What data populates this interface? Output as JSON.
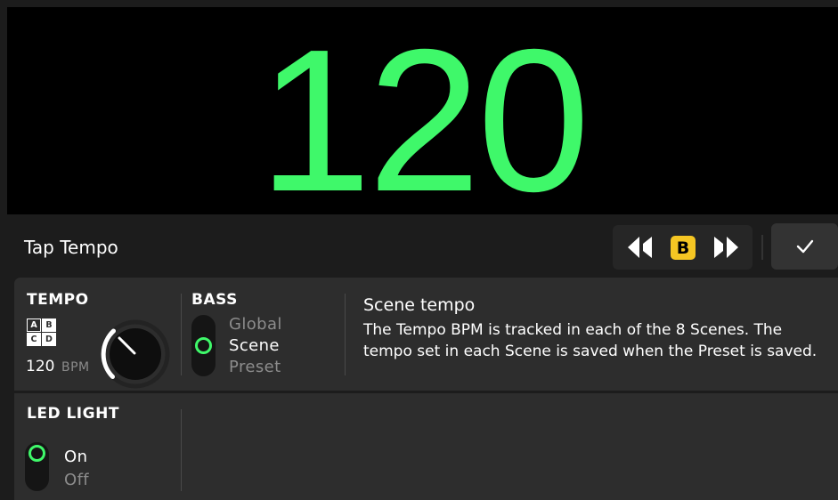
{
  "display": {
    "bpm": "120"
  },
  "header": {
    "title": "Tap Tempo",
    "scene_badge": "B",
    "icons": {
      "prev": "skip-previous-icon",
      "next": "skip-next-icon",
      "confirm": "checkmark-icon"
    }
  },
  "tempo": {
    "label": "TEMPO",
    "grid": [
      "A",
      "B",
      "C",
      "D"
    ],
    "value": "120",
    "unit": "BPM"
  },
  "bass": {
    "label": "BASS",
    "options": [
      "Global",
      "Scene",
      "Preset"
    ],
    "selected": "Scene"
  },
  "help": {
    "title": "Scene tempo",
    "body": "The Tempo BPM is tracked in each of the 8 Scenes. The tempo set in each Scene is saved when the Preset is saved."
  },
  "led": {
    "label": "LED LIGHT",
    "options": [
      "On",
      "Off"
    ],
    "selected": "On"
  },
  "colors": {
    "accent": "#3ff86a",
    "scene_badge": "#f5c623"
  }
}
